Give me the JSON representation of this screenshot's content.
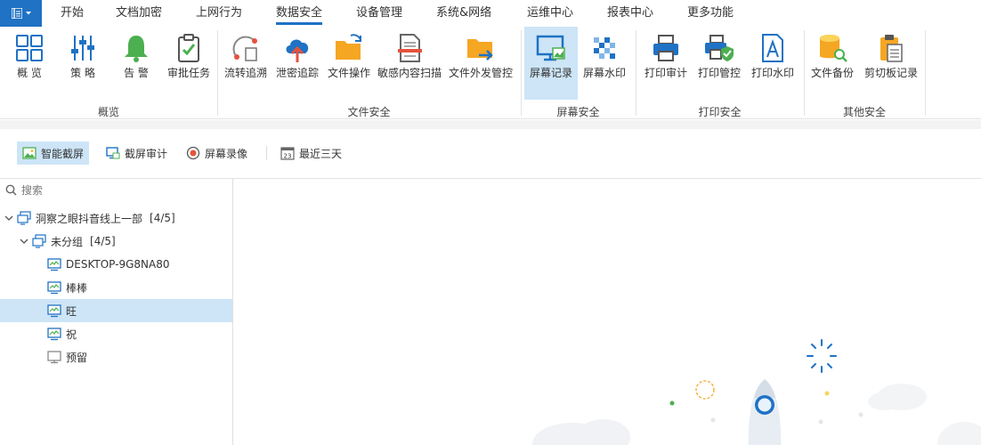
{
  "menubar": {
    "tabs": [
      {
        "label": "开始"
      },
      {
        "label": "文档加密"
      },
      {
        "label": "上网行为"
      },
      {
        "label": "数据安全",
        "active": true
      },
      {
        "label": "设备管理"
      },
      {
        "label": "系统&网络"
      },
      {
        "label": "运维中心"
      },
      {
        "label": "报表中心"
      },
      {
        "label": "更多功能"
      }
    ]
  },
  "ribbon": {
    "groups": [
      {
        "label": "概览",
        "buttons": [
          {
            "label": "概 览",
            "icon": "grid-icon"
          },
          {
            "label": "策 略",
            "icon": "sliders-icon"
          },
          {
            "label": "告 警",
            "icon": "bell-icon"
          },
          {
            "label": "审批任务",
            "icon": "clipboard-check-icon"
          }
        ]
      },
      {
        "label": "文件安全",
        "buttons": [
          {
            "label": "流转追溯",
            "icon": "flow-trace-icon"
          },
          {
            "label": "泄密追踪",
            "icon": "cloud-upload-icon"
          },
          {
            "label": "文件操作",
            "icon": "folder-refresh-icon"
          },
          {
            "label": "敏感内容扫描",
            "icon": "document-scan-icon"
          },
          {
            "label": "文件外发管控",
            "icon": "folder-send-icon"
          }
        ]
      },
      {
        "label": "屏幕安全",
        "buttons": [
          {
            "label": "屏幕记录",
            "icon": "monitor-record-icon",
            "active": true
          },
          {
            "label": "屏幕水印",
            "icon": "mosaic-icon"
          }
        ]
      },
      {
        "label": "打印安全",
        "buttons": [
          {
            "label": "打印审计",
            "icon": "printer-icon"
          },
          {
            "label": "打印管控",
            "icon": "printer-shield-icon"
          },
          {
            "label": "打印水印",
            "icon": "document-letter-icon"
          }
        ]
      },
      {
        "label": "其他安全",
        "buttons": [
          {
            "label": "文件备份",
            "icon": "database-search-icon"
          },
          {
            "label": "剪切板记录",
            "icon": "clipboard-icon"
          }
        ]
      }
    ]
  },
  "toolbar": {
    "smart_capture": "智能截屏",
    "capture_audit": "截屏审计",
    "screen_record": "屏幕录像",
    "date_range": "最近三天",
    "calendar_day": "23"
  },
  "sidebar": {
    "search_placeholder": "搜索",
    "tree": [
      {
        "label": "洞察之眼抖音线上一部",
        "count": "[4/5]",
        "level": 0,
        "expanded": true,
        "kind": "group"
      },
      {
        "label": "未分组",
        "count": "[4/5]",
        "level": 1,
        "expanded": true,
        "kind": "group"
      },
      {
        "label": "DESKTOP-9G8NA80",
        "count": "",
        "level": 2,
        "kind": "pc-online"
      },
      {
        "label": "棒棒",
        "count": "",
        "level": 2,
        "kind": "pc-online"
      },
      {
        "label": "旺",
        "count": "",
        "level": 2,
        "kind": "pc-online",
        "selected": true
      },
      {
        "label": "祝",
        "count": "",
        "level": 2,
        "kind": "pc-online"
      },
      {
        "label": "预留",
        "count": "",
        "level": 2,
        "kind": "pc-offline"
      }
    ]
  },
  "colors": {
    "accent": "#1f72c4",
    "selection": "#cde5f7",
    "icon_blue": "#1f72c4",
    "icon_green": "#4caf50",
    "icon_orange": "#f5a623",
    "icon_red": "#e5533d"
  }
}
